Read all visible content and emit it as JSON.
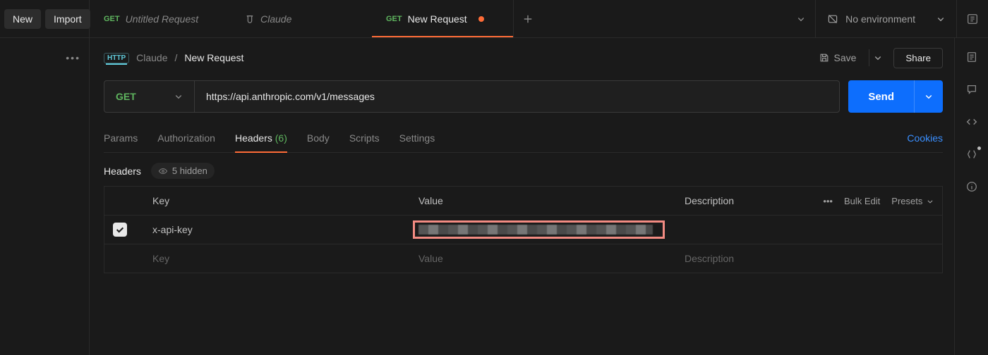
{
  "topbar": {
    "new_label": "New",
    "import_label": "Import",
    "tabs": [
      {
        "method": "GET",
        "title": "Untitled Request"
      },
      {
        "title": "Claude"
      },
      {
        "method": "GET",
        "title": "New Request",
        "dirty": true
      }
    ],
    "env_label": "No environment"
  },
  "breadcrumb": {
    "collection": "Claude",
    "request": "New Request"
  },
  "actions": {
    "save_label": "Save",
    "share_label": "Share"
  },
  "request": {
    "method": "GET",
    "url": "https://api.anthropic.com/v1/messages",
    "send_label": "Send"
  },
  "subtabs": {
    "params": "Params",
    "authorization": "Authorization",
    "headers": "Headers",
    "headers_count": "(6)",
    "body": "Body",
    "scripts": "Scripts",
    "settings": "Settings",
    "cookies": "Cookies"
  },
  "headers_section": {
    "title": "Headers",
    "hidden_label": "5 hidden",
    "columns": {
      "key": "Key",
      "value": "Value",
      "description": "Description"
    },
    "bulk_edit": "Bulk Edit",
    "presets": "Presets",
    "rows": [
      {
        "enabled": true,
        "key": "x-api-key",
        "value_redacted": true
      }
    ],
    "placeholders": {
      "key": "Key",
      "value": "Value",
      "description": "Description"
    }
  }
}
